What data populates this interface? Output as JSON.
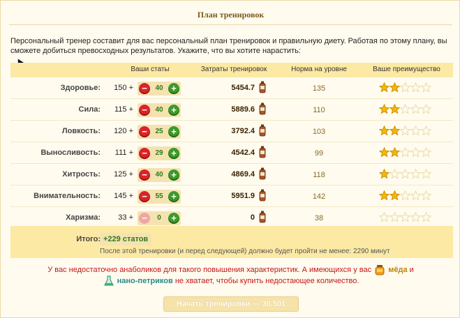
{
  "title": "План тренировок",
  "intro": "Персональный тренер составит для вас персональный план тренировок и правильную диету. Работая по этому плану, вы сможете добиться превосходных результатов. Укажите, что вы хотите нарастить:",
  "headers": {
    "stats": "Ваши статы",
    "cost": "Затраты тренировок",
    "norm": "Норма на уровне",
    "advantage": "Ваше преимущество"
  },
  "rows": [
    {
      "label": "Здоровье:",
      "base": "150",
      "plus": "+",
      "add": "40",
      "cost": "5454.7",
      "norm": "135",
      "stars": 2,
      "minus_disabled": false
    },
    {
      "label": "Сила:",
      "base": "115",
      "plus": "+",
      "add": "40",
      "cost": "5889.6",
      "norm": "110",
      "stars": 2,
      "minus_disabled": false
    },
    {
      "label": "Ловкость:",
      "base": "120",
      "plus": "+",
      "add": "25",
      "cost": "3792.4",
      "norm": "103",
      "stars": 2,
      "minus_disabled": false
    },
    {
      "label": "Выносливость:",
      "base": "111",
      "plus": "+",
      "add": "29",
      "cost": "4542.4",
      "norm": "99",
      "stars": 2,
      "minus_disabled": false
    },
    {
      "label": "Хитрость:",
      "base": "125",
      "plus": "+",
      "add": "40",
      "cost": "4869.4",
      "norm": "118",
      "stars": 1,
      "minus_disabled": false
    },
    {
      "label": "Внимательность:",
      "base": "145",
      "plus": "+",
      "add": "55",
      "cost": "5951.9",
      "norm": "142",
      "stars": 2,
      "minus_disabled": false
    },
    {
      "label": "Харизма:",
      "base": "33",
      "plus": "+",
      "add": "0",
      "cost": "0",
      "norm": "38",
      "stars": 0,
      "minus_disabled": true
    }
  ],
  "total": {
    "label": "Итого:",
    "value": "+229 статов",
    "note": "После этой тренировки (и перед следующей) должно будет пройти не менее: 2290 минут"
  },
  "warning": {
    "part1": "У вас недостаточно анаболиков для такого повышения характеристик. А имеющихся у вас",
    "res1": "мёда",
    "part2": "и",
    "res2": "нано-петриков",
    "part3": "не хватает, чтобы купить недостающее количество."
  },
  "start_button": "Начать тренировки — 30,501",
  "colors": {
    "accent": "#fce9a4",
    "plus": "#3c9a2a",
    "minus": "#d9242b",
    "warning": "#c4161c",
    "star": "#f5b800"
  },
  "icons": {
    "bottle": "anabolic-bottle-icon",
    "honey": "honey-jar-icon",
    "flask": "nano-flask-icon",
    "star": "star-icon"
  }
}
